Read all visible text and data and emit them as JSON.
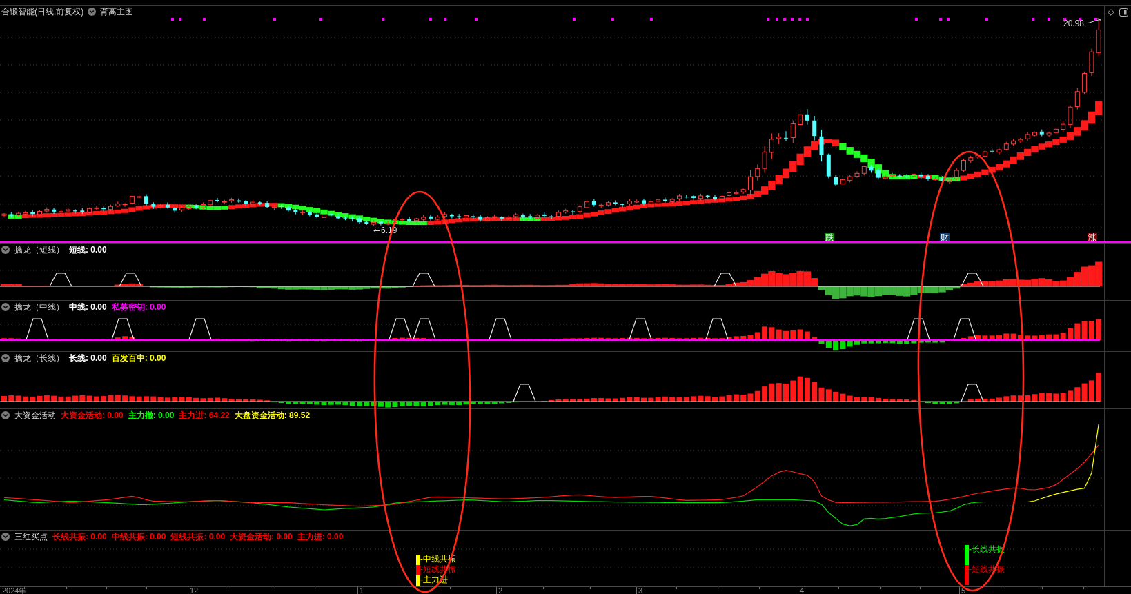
{
  "main_chart": {
    "title": "合锻智能(日线,前复权)",
    "indicator": "背离主图",
    "high_label": "20.98",
    "low_label": "6.19",
    "markers": [
      {
        "text": "跌",
        "color": "#108a10"
      },
      {
        "text": "财",
        "color": "#0b3d6e"
      },
      {
        "text": "涨",
        "color": "#7d0000"
      }
    ]
  },
  "panels": [
    {
      "kind": "short",
      "title": "擒龙（短线）",
      "readouts": [
        {
          "text": "短线: 0.00",
          "color": "#ffffff"
        }
      ]
    },
    {
      "kind": "mid",
      "title": "擒龙（中线）",
      "readouts": [
        {
          "text": "中线: 0.00",
          "color": "#ffffff"
        },
        {
          "text": "私募密钥: 0.00",
          "color": "#ff00ff"
        }
      ]
    },
    {
      "kind": "long",
      "title": "擒龙（长线）",
      "readouts": [
        {
          "text": "长线: 0.00",
          "color": "#ffffff"
        },
        {
          "text": "百发百中: 0.00",
          "color": "#ffff00"
        }
      ]
    },
    {
      "kind": "funds",
      "title": "大资金活动",
      "readouts": [
        {
          "text": "大资金活动: 0.00",
          "color": "#ff0000"
        },
        {
          "text": "主力撤: 0.00",
          "color": "#00ff00"
        },
        {
          "text": "主力进: 64.22",
          "color": "#ff0000"
        },
        {
          "text": "大盘资金活动: 89.52",
          "color": "#ffff00"
        }
      ]
    },
    {
      "kind": "signals",
      "title": "三红买点",
      "readouts": [
        {
          "text": "长线共振: 0.00",
          "color": "#ff0000"
        },
        {
          "text": "中线共振: 0.00",
          "color": "#ff0000"
        },
        {
          "text": "短线共振: 0.00",
          "color": "#ff0000"
        },
        {
          "text": "大资金活动: 0.00",
          "color": "#ff0000"
        },
        {
          "text": "主力进: 0.00",
          "color": "#ff0000"
        }
      ],
      "signals": [
        {
          "items": [
            {
              "text": "-中线共振",
              "color": "#ffff00"
            },
            {
              "text": "-短线共振",
              "color": "#ff0000"
            },
            {
              "text": "-主力进",
              "color": "#ffff00"
            }
          ]
        },
        {
          "items": [
            {
              "text": "-长线共振",
              "color": "#00ff00"
            },
            {
              "text": "-短线共振",
              "color": "#ff0000"
            }
          ]
        }
      ]
    }
  ],
  "x_axis": {
    "labels": [
      "2024年",
      "12",
      "1",
      "2",
      "3",
      "4",
      "5"
    ]
  }
}
